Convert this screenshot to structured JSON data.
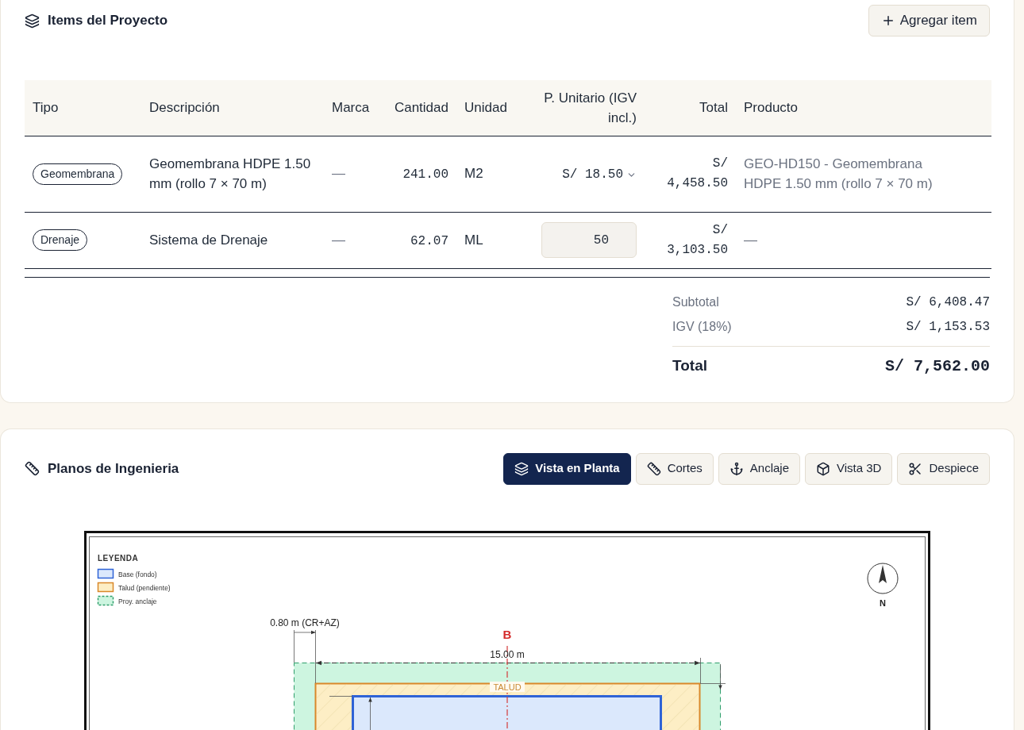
{
  "items_section": {
    "title": "Items del Proyecto",
    "add_button": "Agregar item",
    "columns": [
      "Tipo",
      "Descripción",
      "Marca",
      "Cantidad",
      "Unidad",
      "P. Unitario (IGV incl.)",
      "Total",
      "Producto"
    ],
    "rows": [
      {
        "tipo": "Geomembrana",
        "descripcion": "Geomembrana HDPE 1.50 mm (rollo 7 × 70 m)",
        "marca": "—",
        "cantidad": "241.00",
        "unidad": "M2",
        "precio": {
          "kind": "select",
          "value": "S/ 18.50"
        },
        "total": "S/ 4,458.50",
        "producto": "GEO-HD150 - Geomembrana HDPE 1.50 mm (rollo 7 × 70 m)"
      },
      {
        "tipo": "Drenaje",
        "descripcion": "Sistema de Drenaje",
        "marca": "—",
        "cantidad": "62.07",
        "unidad": "ML",
        "precio": {
          "kind": "input",
          "value": "50"
        },
        "total": "S/ 3,103.50",
        "producto": "—"
      }
    ],
    "totals": [
      {
        "kind": "line",
        "label": "Subtotal",
        "value": "S/ 6,408.47"
      },
      {
        "kind": "line",
        "label": "IGV (18%)",
        "value": "S/ 1,153.53"
      },
      {
        "kind": "grand",
        "label": "Total",
        "value": "S/ 7,562.00"
      }
    ]
  },
  "plans_section": {
    "title": "Planos de Ingenieria",
    "tabs": [
      {
        "label": "Vista en Planta",
        "selected": true
      },
      {
        "label": "Cortes",
        "selected": false
      },
      {
        "label": "Anclaje",
        "selected": false
      },
      {
        "label": "Vista 3D",
        "selected": false
      },
      {
        "label": "Despiece",
        "selected": false
      }
    ],
    "drawing": {
      "legend_title": "LEYENDA",
      "legend": [
        {
          "kind": "base",
          "label": "Base (fondo)"
        },
        {
          "kind": "slope",
          "label": "Talud (pendiente)"
        },
        {
          "kind": "anchor",
          "label": "Proy. anclaje"
        }
      ],
      "anchor_dimension": "0.80 m (CR+AZ)",
      "section_mark": "B",
      "width_dimension": "15.00 m",
      "slope_label": "TALUD",
      "north_label": "N"
    }
  }
}
